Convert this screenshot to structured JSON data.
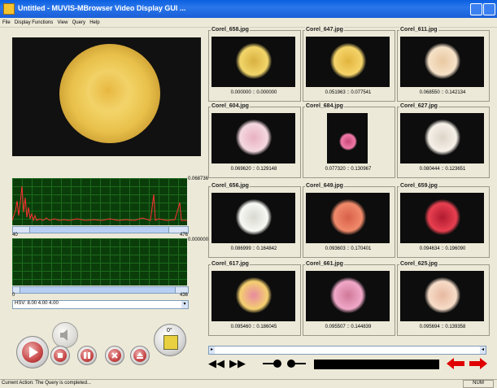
{
  "window": {
    "title": "Untitled  - MUVIS-MBrowser Video Display GUI ..."
  },
  "menu": [
    "File",
    "Display Functions",
    "View",
    "Query",
    "Help"
  ],
  "histogram": {
    "max_label": "0.068736",
    "x_min": "40",
    "x_max": "476"
  },
  "second_plot": {
    "max_label": "0.000000",
    "x_min": "0",
    "x_max": "436"
  },
  "feature_select": {
    "value": "HSV: 8.00  4.00  4.00"
  },
  "rotate_label": "0°",
  "results": [
    {
      "name": "Corel_658.jpg",
      "score": "0.000000 :: 0.000000"
    },
    {
      "name": "Corel_647.jpg",
      "score": "0.051963 :: 0.077541"
    },
    {
      "name": "Corel_611.jpg",
      "score": "0.068550 :: 0.142134"
    },
    {
      "name": "Corel_604.jpg",
      "score": "0.069620 :: 0.129148"
    },
    {
      "name": "Corel_684.jpg",
      "score": "0.077320 :: 0.130967"
    },
    {
      "name": "Corel_627.jpg",
      "score": "0.080444 :: 0.123651"
    },
    {
      "name": "Corel_656.jpg",
      "score": "0.086999 :: 0.164842"
    },
    {
      "name": "Corel_649.jpg",
      "score": "0.093603 :: 0.170401"
    },
    {
      "name": "Corel_659.jpg",
      "score": "0.094634 :: 0.196090"
    },
    {
      "name": "Corel_617.jpg",
      "score": "0.095460 :: 0.186045"
    },
    {
      "name": "Corel_661.jpg",
      "score": "0.095507 :: 0.144839"
    },
    {
      "name": "Corel_625.jpg",
      "score": "0.095694 :: 0.139358"
    }
  ],
  "status": {
    "message": "Current Action: The Query is completed...",
    "indicator": "NUM"
  }
}
